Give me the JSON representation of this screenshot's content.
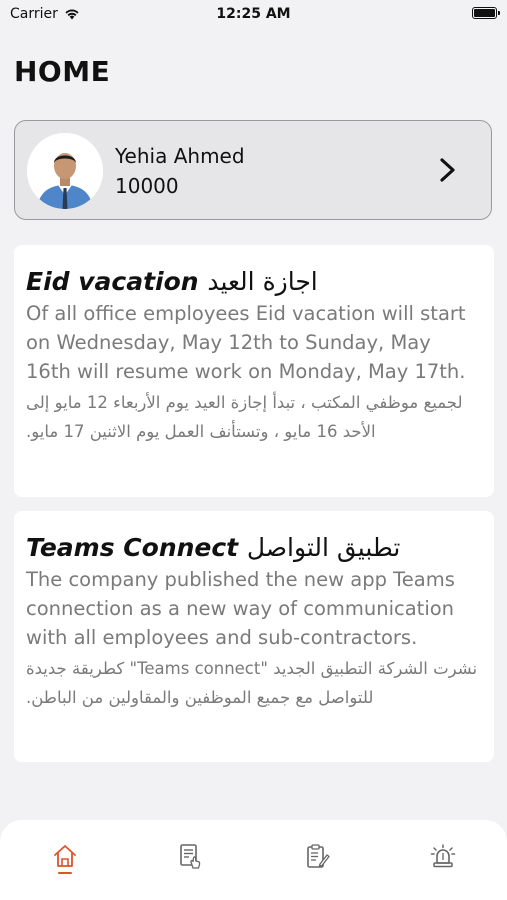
{
  "status_bar": {
    "carrier": "Carrier",
    "time": "12:25 AM"
  },
  "page": {
    "title": "HOME"
  },
  "profile": {
    "name": "Yehia Ahmed",
    "id": "10000"
  },
  "news": [
    {
      "title_en": "Eid vacation",
      "title_ar": "اجازة العيد",
      "body_en": "Of all office employees Eid vacation will start on Wednesday, May 12th to Sunday, May 16th will resume work on Monday, May 17th.",
      "body_ar": "لجميع موظفي المكتب ، تبدأ إجازة العيد يوم الأربعاء 12 مايو إلى الأحد 16 مايو ، وتستأنف العمل يوم الاثنين 17 مايو."
    },
    {
      "title_en": "Teams Connect",
      "title_ar": "تطبيق التواصل",
      "body_en": "The company published the new app Teams connection as a new way of communication with all employees and sub-contractors.",
      "body_ar": "نشرت الشركة التطبيق الجديد \"Teams connect\" كطريقة جديدة للتواصل مع جميع الموظفين والمقاولين من الباطن."
    }
  ],
  "tabs": [
    {
      "icon": "home-icon",
      "active": true
    },
    {
      "icon": "document-touch-icon",
      "active": false
    },
    {
      "icon": "clipboard-edit-icon",
      "active": false
    },
    {
      "icon": "alarm-icon",
      "active": false
    }
  ],
  "colors": {
    "accent": "#e0522a",
    "muted_text": "#7a7a7a",
    "card_border": "#9a9a9e"
  }
}
